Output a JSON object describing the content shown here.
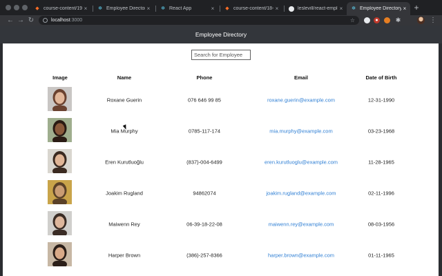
{
  "browser": {
    "tabs": [
      {
        "title": "course-content/19-",
        "icon": "gitlab-icon",
        "active": false
      },
      {
        "title": "Employee Directory",
        "icon": "react-favicon-icon",
        "active": false
      },
      {
        "title": "React App",
        "icon": "react-favicon-icon",
        "active": false
      },
      {
        "title": "course-content/18-",
        "icon": "gitlab-icon",
        "active": false
      },
      {
        "title": "leslevill/react-emplo",
        "icon": "github-icon",
        "active": false
      },
      {
        "title": "Employee Directory",
        "icon": "react-favicon-icon",
        "active": true
      }
    ],
    "url_host": "localhost",
    "url_port": ":3000",
    "colors": {
      "tabstrip": "#202124",
      "toolbar": "#35363a"
    }
  },
  "app": {
    "title": "Employee Directory",
    "header_color": "#33363b",
    "link_color": "#2f7fd4"
  },
  "search": {
    "placeholder": "Search for Employee",
    "value": ""
  },
  "table": {
    "headers": {
      "image": "Image",
      "name": "Name",
      "phone": "Phone",
      "email": "Email",
      "dob": "Date of Birth"
    },
    "rows": [
      {
        "name": "Roxane Guerin",
        "phone": "076 646 99 85",
        "email": "roxane.guerin@example.com",
        "dob": "12-31-1990",
        "hair": "#6b4230",
        "skin": "#e2b79a",
        "bg": "#c9c6c4"
      },
      {
        "name": "Mia Murphy",
        "phone": "0785-117-174",
        "email": "mia.murphy@example.com",
        "dob": "03-23-1968",
        "hair": "#2a1b14",
        "skin": "#8a5a3c",
        "bg": "#9fae8e"
      },
      {
        "name": "Eren Kurutluoğlu",
        "phone": "(837)-004-6499",
        "email": "eren.kurutluoglu@example.com",
        "dob": "11-28-1965",
        "hair": "#3b2a20",
        "skin": "#e0b596",
        "bg": "#d9d6cf"
      },
      {
        "name": "Joakim Rugland",
        "phone": "94862074",
        "email": "joakim.rugland@example.com",
        "dob": "02-11-1996",
        "hair": "#5a4128",
        "skin": "#c99c73",
        "bg": "#c9a44a"
      },
      {
        "name": "Maiwenn Rey",
        "phone": "06-39-18-22-08",
        "email": "maiwenn.rey@example.com",
        "dob": "08-03-1956",
        "hair": "#3a2c25",
        "skin": "#ddb69c",
        "bg": "#d0cfcc"
      },
      {
        "name": "Harper Brown",
        "phone": "(386)-257-8366",
        "email": "harper.brown@example.com",
        "dob": "01-11-1965",
        "hair": "#2b1e18",
        "skin": "#d8a988",
        "bg": "#c7b7a4"
      }
    ]
  }
}
